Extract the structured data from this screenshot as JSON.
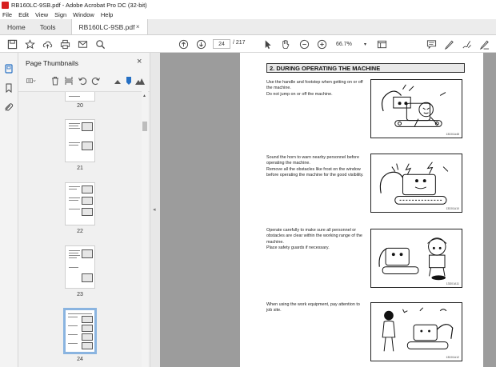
{
  "window": {
    "title": "RB160LC-9SB.pdf - Adobe Acrobat Pro DC (32-bit)"
  },
  "menu": [
    "File",
    "Edit",
    "View",
    "Sign",
    "Window",
    "Help"
  ],
  "tabs": {
    "home": "Home",
    "tools": "Tools",
    "document": "RB160LC-9SB.pdf",
    "close": "×"
  },
  "toolbar": {
    "current_page": "24",
    "total_pages": "/ 217",
    "zoom": "66.7%"
  },
  "panel": {
    "title": "Page Thumbnails",
    "close": "×",
    "thumbnails": [
      {
        "label": "20"
      },
      {
        "label": "21"
      },
      {
        "label": "22"
      },
      {
        "label": "23"
      },
      {
        "label": "24",
        "selected": true
      }
    ]
  },
  "page": {
    "heading": "2. DURING OPERATING THE MACHINE",
    "sections": [
      {
        "text": "Use the handle and footstep when getting on or off the machine.\nDo not jump on or off the machine.",
        "code": "13D01A48"
      },
      {
        "text": "Sound the horn to warn nearby personnel before operating the machine.\nRemove all the obstacles like frost on the window before operating the machine for the good visibility.",
        "code": "13D01A10"
      },
      {
        "text": "Operate carefully to make sure all personnel or obstacles are clear within the working range of the machine.\nPlace safety guards if necessary.",
        "code": "13D01A11"
      },
      {
        "text": "When using the work equipment, pay attention to job site.",
        "code": "13D01A12"
      }
    ]
  },
  "colors": {
    "acrobat_red": "#d71f1f",
    "selection_blue": "#8ab4e0",
    "viewer_bg": "#9c9c9c"
  }
}
